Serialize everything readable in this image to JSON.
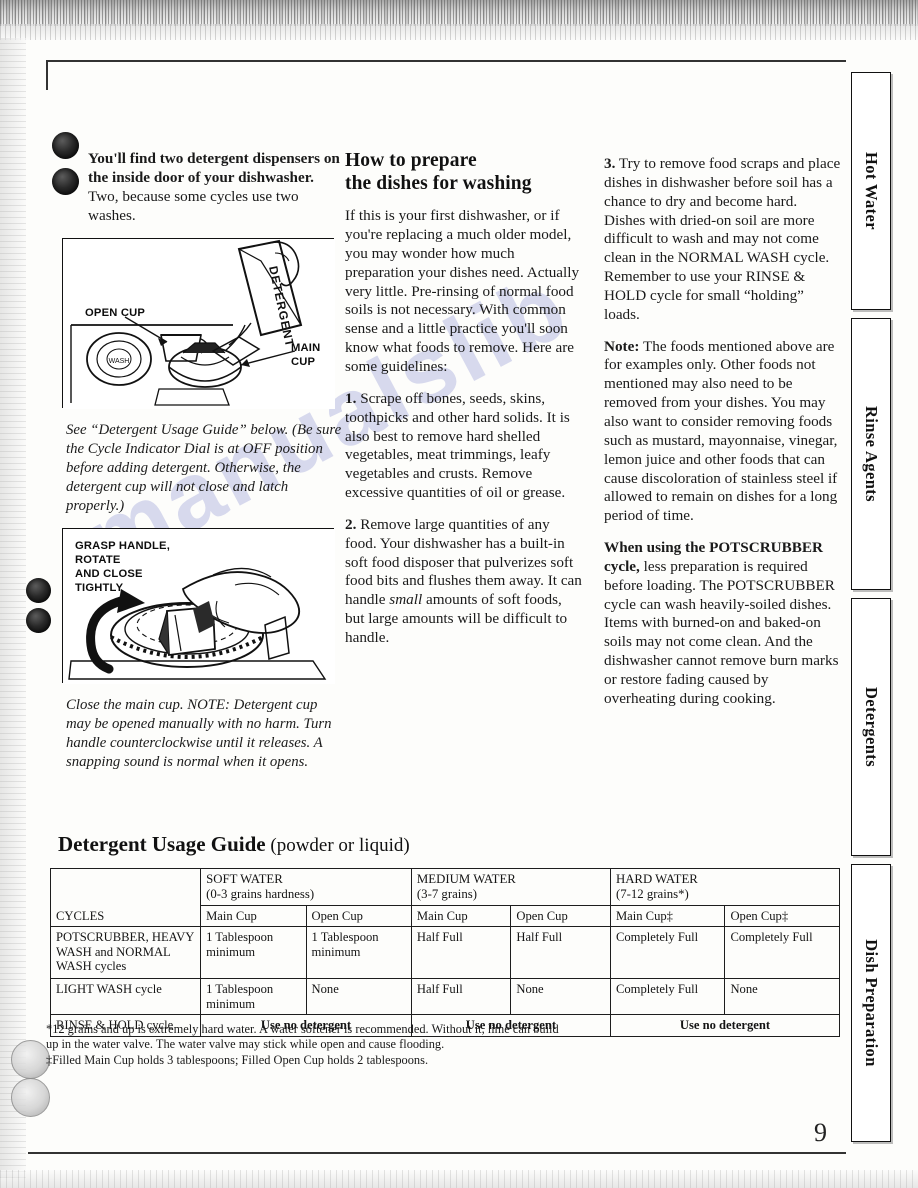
{
  "document": {
    "page_number": "9",
    "watermark_text": "manualslib"
  },
  "left_column": {
    "intro_bold": "You'll find two detergent dispensers on the inside door of your dishwasher.",
    "intro_rest": " Two, because some cycles use two washes.",
    "illustration_one": {
      "label_open_cup": "OPEN CUP",
      "label_main_cup": "MAIN CUP",
      "label_detergent_box": "DETERGENT"
    },
    "caption_one": "See “Detergent Usage Guide” below. (Be sure the Cycle Indicator Dial is at OFF position before adding detergent. Otherwise, the detergent cup will not close and latch properly.)",
    "illustration_two": {
      "label_grasp": "GRASP HANDLE,\nROTATE\nAND CLOSE\nTIGHTLY"
    },
    "caption_two": "Close the main cup. NOTE: Detergent cup may be opened manually with no harm. Turn handle counterclockwise until it releases. A snapping sound is normal when it opens."
  },
  "middle_column": {
    "heading_line1": "How to prepare",
    "heading_line2": "the dishes for washing",
    "paragraph_intro": "If this is your first dishwasher, or if you're replacing a much older model, you may wonder how much preparation your dishes need. Actually very little. Pre-rinsing of normal food soils is not necessary. With common sense and a little practice you'll soon know what foods to remove. Here are some guidelines:",
    "step_1_num": "1.",
    "step_1_text": " Scrape off bones, seeds, skins, toothpicks and other hard solids. It is also best to remove hard shelled vegetables, meat trimmings, leafy vegetables and crusts. Remove excessive quantities of oil or grease.",
    "step_2_num": "2.",
    "step_2_text_a": " Remove large quantities of any food. Your dishwasher has a built-in soft food disposer that pulverizes soft food bits and flushes them away. It can handle ",
    "step_2_emph": "small",
    "step_2_text_b": " amounts of soft foods, but large amounts will be difficult to handle."
  },
  "right_column": {
    "step_3_num": "3.",
    "step_3_text": " Try to remove food scraps and place dishes in dishwasher before soil has a chance to dry and become hard. Dishes with dried-on soil are more difficult to wash and may not come clean in the NORMAL WASH cycle. Remember to use your RINSE & HOLD cycle for small “holding” loads.",
    "note_label": "Note:",
    "note_text": " The foods mentioned above are for examples only. Other foods not mentioned may also need to be removed from your dishes. You may also want to consider removing foods such as mustard, mayonnaise, vinegar, lemon juice and other foods that can cause discoloration of stainless steel if allowed to remain on dishes for a long period of time.",
    "potscrubber_bold": "When using the POTSCRUBBER cycle,",
    "potscrubber_text": " less preparation is required before loading. The POTSCRUBBER cycle can wash heavily-soiled dishes. Items with burned-on and baked-on soils may not come clean. And the dishwasher cannot remove burn marks or restore fading caused by overheating during cooking."
  },
  "usage_guide": {
    "title_bold": "Detergent Usage Guide",
    "title_light": " (powder or liquid)",
    "cycles_header": "CYCLES",
    "groups": [
      {
        "name": "SOFT WATER",
        "sub": "(0-3 grains hardness)",
        "cups": [
          "Main Cup",
          "Open Cup"
        ]
      },
      {
        "name": "MEDIUM WATER",
        "sub": "(3-7 grains)",
        "cups": [
          "Main Cup",
          "Open Cup"
        ]
      },
      {
        "name": "HARD WATER",
        "sub": "(7-12 grains*)",
        "cups": [
          "Main Cup‡",
          "Open Cup‡"
        ]
      }
    ],
    "rows": [
      {
        "cycle": "POTSCRUBBER, HEAVY WASH and NORMAL WASH cycles",
        "values": [
          "1 Tablespoon minimum",
          "1 Tablespoon minimum",
          "Half Full",
          "Half Full",
          "Completely Full",
          "Completely Full"
        ]
      },
      {
        "cycle": "LIGHT WASH cycle",
        "values": [
          "1 Tablespoon minimum",
          "None",
          "Half Full",
          "None",
          "Completely Full",
          "None"
        ]
      }
    ],
    "rinse_hold_row": {
      "cycle": "RINSE & HOLD cycle",
      "soft": "Use no detergent",
      "medium": "Use no detergent",
      "hard": "Use no detergent"
    },
    "footnotes": [
      "*12 grains and up is extremely hard water. A water softener is recommended. Without it, lime can build up in the water valve. The water valve may stick while open and cause flooding.",
      "‡Filled Main Cup holds 3 tablespoons; Filled Open Cup holds 2 tablespoons."
    ]
  },
  "side_tabs": [
    {
      "label": "Hot Water"
    },
    {
      "label": "Rinse Agents"
    },
    {
      "label": "Detergents"
    },
    {
      "label": "Dish Preparation"
    }
  ]
}
